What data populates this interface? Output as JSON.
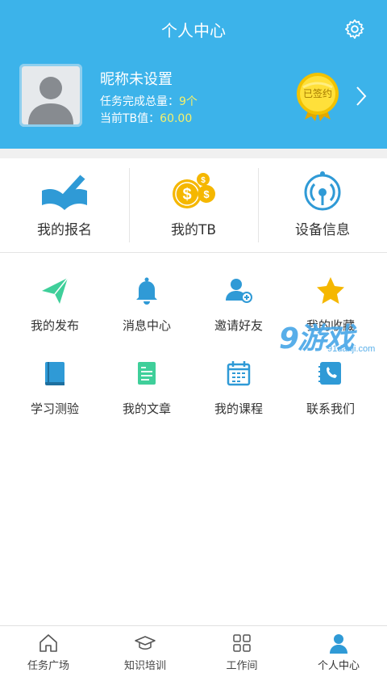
{
  "header": {
    "title": "个人中心",
    "accent_color": "#3cb3ea",
    "settings_icon": "gear-icon"
  },
  "profile": {
    "nickname": "昵称未设置",
    "task_label": "任务完成总量：",
    "task_value": "9个",
    "tb_label": "当前TB值：",
    "tb_value": "60.00",
    "sign_badge": "已签约"
  },
  "quick_actions": [
    {
      "label": "我的报名",
      "icon": "book-pen-icon"
    },
    {
      "label": "我的TB",
      "icon": "coins-icon"
    },
    {
      "label": "设备信息",
      "icon": "device-signal-icon"
    }
  ],
  "menu": [
    {
      "label": "我的发布",
      "icon": "paper-plane-icon"
    },
    {
      "label": "消息中心",
      "icon": "bell-icon"
    },
    {
      "label": "邀请好友",
      "icon": "add-user-icon"
    },
    {
      "label": "我的收藏",
      "icon": "star-icon"
    },
    {
      "label": "学习测验",
      "icon": "notebook-icon"
    },
    {
      "label": "我的文章",
      "icon": "document-icon"
    },
    {
      "label": "我的课程",
      "icon": "calendar-icon"
    },
    {
      "label": "联系我们",
      "icon": "phone-book-icon"
    }
  ],
  "watermark": {
    "big": "9游戏",
    "small": "91danji.com"
  },
  "bottom_nav": [
    {
      "label": "任务广场",
      "icon": "home-icon",
      "active": false
    },
    {
      "label": "知识培训",
      "icon": "graduation-cap-icon",
      "active": false
    },
    {
      "label": "工作间",
      "icon": "grid-icon",
      "active": false
    },
    {
      "label": "个人中心",
      "icon": "person-icon",
      "active": true
    }
  ]
}
